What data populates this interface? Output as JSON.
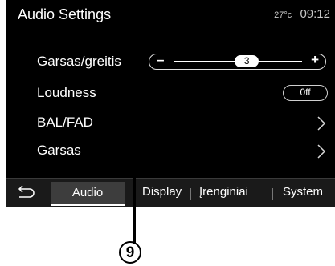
{
  "header": {
    "title": "Audio Settings",
    "temperature": "27°c",
    "time": "09:12"
  },
  "settings": [
    {
      "label": "Garsas/greitis",
      "control": "slider",
      "value": "3",
      "minus": "–",
      "plus": "+"
    },
    {
      "label": "Loudness",
      "control": "toggle",
      "value": "0ff"
    },
    {
      "label": "BAL/FAD",
      "control": "chevron",
      "icon": "chevron-right-icon"
    },
    {
      "label": "Garsas",
      "control": "chevron",
      "icon": "chevron-right-icon"
    }
  ],
  "slider_level_fraction": 0.57,
  "tabs": [
    {
      "label": "Audio",
      "active": true
    },
    {
      "label": "Display",
      "active": false
    },
    {
      "label": "Įrenginiai",
      "active": false
    },
    {
      "label": "System",
      "active": false
    }
  ],
  "back_icon": "back-arrow-icon",
  "callout": {
    "number": "9"
  },
  "colors": {
    "background": "#000000",
    "text": "#ffffff",
    "tabbar": "#1a1a1a",
    "active_tab": "#3d3d3d"
  }
}
